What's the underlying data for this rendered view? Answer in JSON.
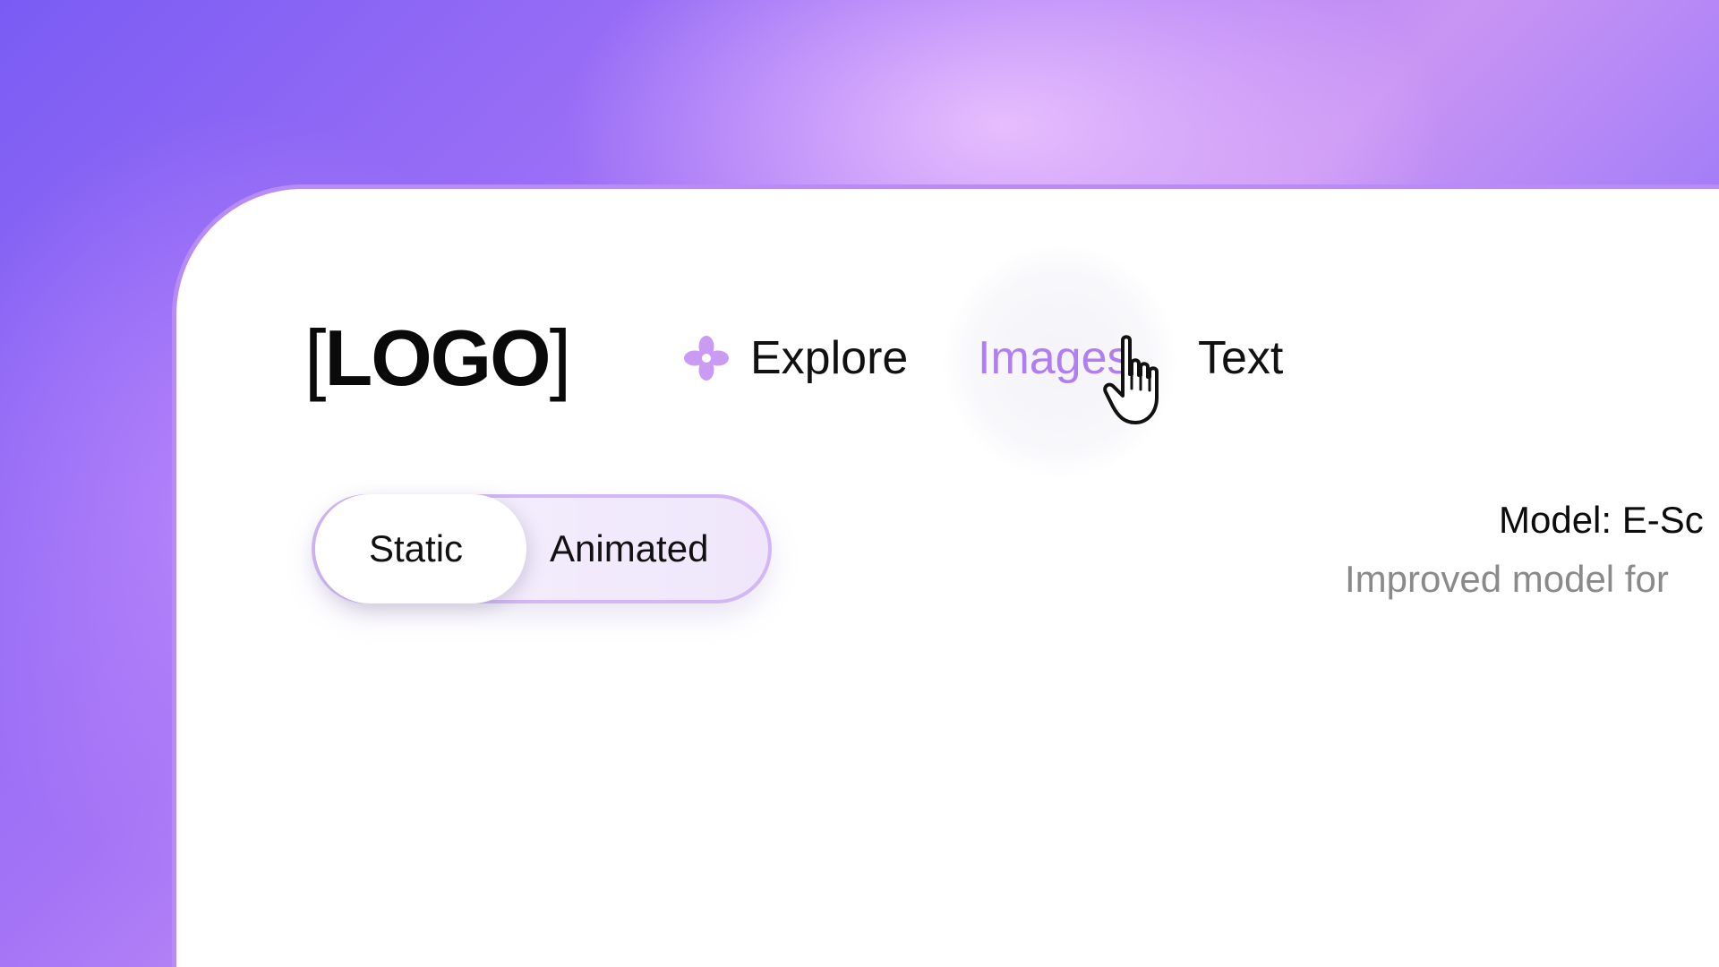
{
  "brand": {
    "logo_open": "[",
    "logo_text": "LOGO",
    "logo_close": "]"
  },
  "nav": {
    "items": [
      {
        "label": "Explore",
        "icon": "flower-icon",
        "state": "default"
      },
      {
        "label": "Images",
        "state": "hover"
      },
      {
        "label": "Text",
        "state": "default"
      }
    ]
  },
  "toggle": {
    "options": [
      {
        "label": "Static",
        "selected": true
      },
      {
        "label": "Animated",
        "selected": false
      }
    ]
  },
  "model": {
    "title": "Model: E-Sc",
    "description": "Improved model for"
  },
  "colors": {
    "accent": "#b07ef0",
    "border": "#b88cf7",
    "text_primary": "#111111",
    "text_secondary": "#8a8a8a"
  },
  "cursor": {
    "icon": "hand-pointer-icon"
  }
}
